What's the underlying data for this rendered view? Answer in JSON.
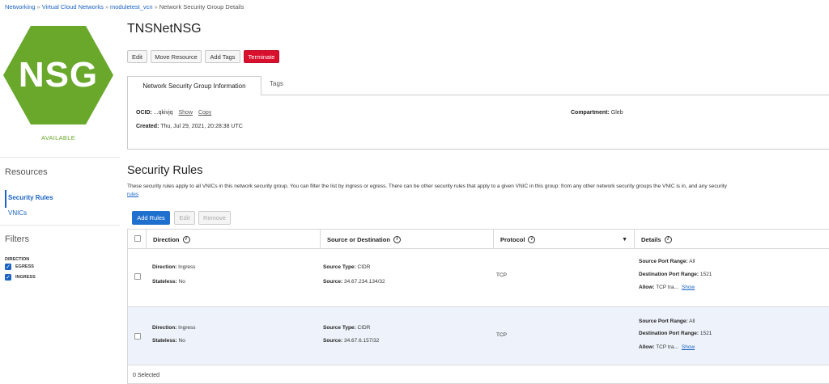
{
  "breadcrumb": {
    "items": [
      "Networking",
      "Virtual Cloud Networks",
      "moduletest_vcn"
    ],
    "current": "Network Security Group Details"
  },
  "badge": {
    "text": "NSG",
    "color": "#6aa82c"
  },
  "status": "AVAILABLE",
  "sidebar": {
    "resources_heading": "Resources",
    "items": [
      {
        "label": "Security Rules",
        "active": true
      },
      {
        "label": "VNICs",
        "active": false
      }
    ],
    "filters_heading": "Filters",
    "filter_group_label": "DIRECTION",
    "filter_options": [
      {
        "label": "EGRESS",
        "checked": true
      },
      {
        "label": "INGRESS",
        "checked": true
      }
    ]
  },
  "header": {
    "title": "TNSNetNSG"
  },
  "actions": {
    "edit": "Edit",
    "move_resource": "Move Resource",
    "add_tags": "Add Tags",
    "terminate": "Terminate"
  },
  "tabs": [
    {
      "label": "Network Security Group Information",
      "active": true
    },
    {
      "label": "Tags",
      "active": false
    }
  ],
  "info": {
    "ocid_label": "OCID:",
    "ocid_value": "...qkivjq",
    "show": "Show",
    "copy": "Copy",
    "created_label": "Created:",
    "created_value": "Thu, Jul 29, 2021, 20:28:38 UTC",
    "compartment_label": "Compartment:",
    "compartment_value": "Gleb"
  },
  "security_rules": {
    "heading": "Security Rules",
    "description": "These security rules apply to all VNICs in this network security group. You can filter the list by ingress or egress. There can be other security rules that apply to a given VNIC in this group: from any other network security groups the VNIC is in, and any security",
    "description_link": "rules",
    "buttons": {
      "add": "Add Rules",
      "edit": "Edit",
      "remove": "Remove"
    },
    "columns": [
      "Direction",
      "Source or Destination",
      "Protocol",
      "Details"
    ],
    "rows": [
      {
        "direction_label": "Direction:",
        "direction": "Ingress",
        "stateless_label": "Stateless:",
        "stateless": "No",
        "source_type_label": "Source Type:",
        "source_type": "CIDR",
        "source_label": "Source:",
        "source": "34.67.234.134/32",
        "protocol": "TCP",
        "src_port_label": "Source Port Range:",
        "src_port": "All",
        "dst_port_label": "Destination Port Range:",
        "dst_port": "1521",
        "allow_label": "Allow:",
        "allow": "TCP tra...",
        "show": "Show"
      },
      {
        "direction_label": "Direction:",
        "direction": "Ingress",
        "stateless_label": "Stateless:",
        "stateless": "No",
        "source_type_label": "Source Type:",
        "source_type": "CIDR",
        "source_label": "Source:",
        "source": "34.67.6.157/32",
        "protocol": "TCP",
        "src_port_label": "Source Port Range:",
        "src_port": "All",
        "dst_port_label": "Destination Port Range:",
        "dst_port": "1521",
        "allow_label": "Allow:",
        "allow": "TCP tra...",
        "show": "Show"
      }
    ],
    "selected_count": "0 Selected"
  },
  "colors": {
    "link": "#1a63c4",
    "primary_button": "#1f6fcf",
    "terminate_button": "#d8102e",
    "status_green": "#6aa82c",
    "row_highlight": "#eef3fb"
  }
}
